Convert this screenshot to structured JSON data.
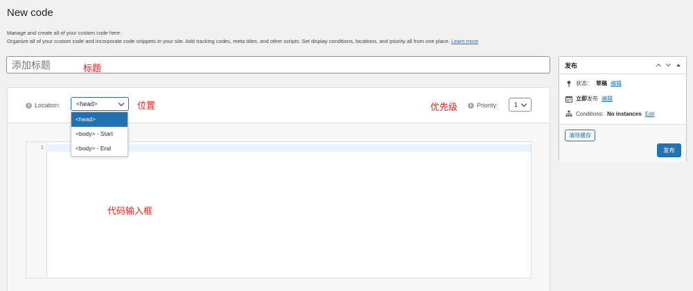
{
  "page": {
    "title": "New code",
    "desc_line1": "Manage and create all of your custom code here.",
    "desc_line2": "Organize all of your custom code and incorporate code snippets in your site. Add tracking codes, meta titles, and other scripts. Set display conditions, locations, and priority all from one place.",
    "learn_more": "Learn more"
  },
  "title_field": {
    "placeholder": "添加标题"
  },
  "annotations": {
    "title": "标题",
    "location": "位置",
    "priority": "优先级",
    "code_input": "代码输入框"
  },
  "location": {
    "label": "Location:",
    "selected": "<head>",
    "options": [
      "<head>",
      "<body> - Start",
      "<body> - End"
    ]
  },
  "priority": {
    "label": "Priority:",
    "selected": "1"
  },
  "editor": {
    "line_number": "1"
  },
  "publish_box": {
    "title": "发布",
    "status_label": "状态：",
    "status_value": "草稿",
    "status_edit": "编辑",
    "schedule_label_bold": "立即",
    "schedule_label": "发布",
    "schedule_edit": "编辑",
    "conditions_label": "Conditions:",
    "conditions_value": "No instances",
    "conditions_edit": "Edit",
    "clear_cache_btn": "清除缓存",
    "publish_btn": "发布"
  },
  "colors": {
    "accent": "#2271b1",
    "annotation": "#e0201d",
    "background": "#f0f0f1"
  }
}
